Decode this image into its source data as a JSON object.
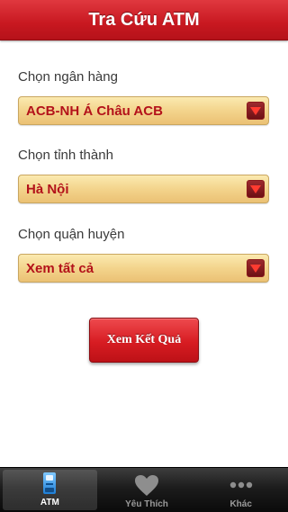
{
  "navbar": {
    "title": "Tra Cứu ATM"
  },
  "form": {
    "bank": {
      "label": "Chọn ngân hàng",
      "value": "ACB-NH Á Châu ACB"
    },
    "province": {
      "label": "Chọn tỉnh thành",
      "value": "Hà Nội"
    },
    "district": {
      "label": "Chọn quận huyện",
      "value": "Xem tất cả"
    },
    "submit_label": "Xem Kết Quả"
  },
  "tabbar": {
    "tabs": [
      {
        "label": "ATM",
        "icon": "atm-icon",
        "active": true
      },
      {
        "label": "Yêu Thích",
        "icon": "heart-icon",
        "active": false
      },
      {
        "label": "Khác",
        "icon": "more-icon",
        "active": false
      }
    ]
  },
  "colors": {
    "accent_red": "#c81820",
    "select_gold": "#f3d48c",
    "select_text": "#b3121a",
    "tabbar_bg": "#1c1c1c"
  }
}
